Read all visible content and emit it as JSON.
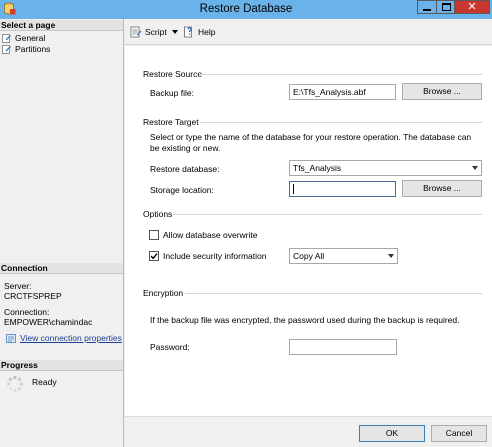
{
  "window": {
    "title": "Restore Database",
    "close_glyph": "✕",
    "icon": "sql-database-icon"
  },
  "left_pane": {
    "select_page_header": "Select a page",
    "pages": [
      {
        "label": "General",
        "icon": "page-wrench-icon"
      },
      {
        "label": "Partitions",
        "icon": "page-wrench-icon"
      }
    ],
    "connection_header": "Connection",
    "server_label": "Server:",
    "server_value": "CRCTFSPREP",
    "connection_label": "Connection:",
    "connection_value": "EMPOWER\\chamindac",
    "view_connection_properties": "View connection properties",
    "progress_header": "Progress",
    "progress_status": "Ready"
  },
  "toolbar": {
    "script_label": "Script",
    "help_label": "Help"
  },
  "restore_source": {
    "title": "Restore Source",
    "backup_file_label": "Backup file:",
    "backup_file_value": "E:\\Tfs_Analysis.abf",
    "browse_label": "Browse ..."
  },
  "restore_target": {
    "title": "Restore Target",
    "description": "Select or type the name of the database for your restore operation. The database can be existing or new.",
    "restore_database_label": "Restore database:",
    "restore_database_value": "Tfs_Analysis",
    "storage_location_label": "Storage location:",
    "storage_location_value": "",
    "browse_label": "Browse ..."
  },
  "options": {
    "title": "Options",
    "allow_overwrite_label": "Allow database overwrite",
    "allow_overwrite_checked": false,
    "include_security_label": "Include security information",
    "include_security_checked": true,
    "security_option_value": "Copy All"
  },
  "encryption": {
    "title": "Encryption",
    "description": "If the backup file was encrypted, the password used during the backup is required.",
    "password_label": "Password:",
    "password_value": ""
  },
  "buttons": {
    "ok_label": "OK",
    "cancel_label": "Cancel"
  }
}
